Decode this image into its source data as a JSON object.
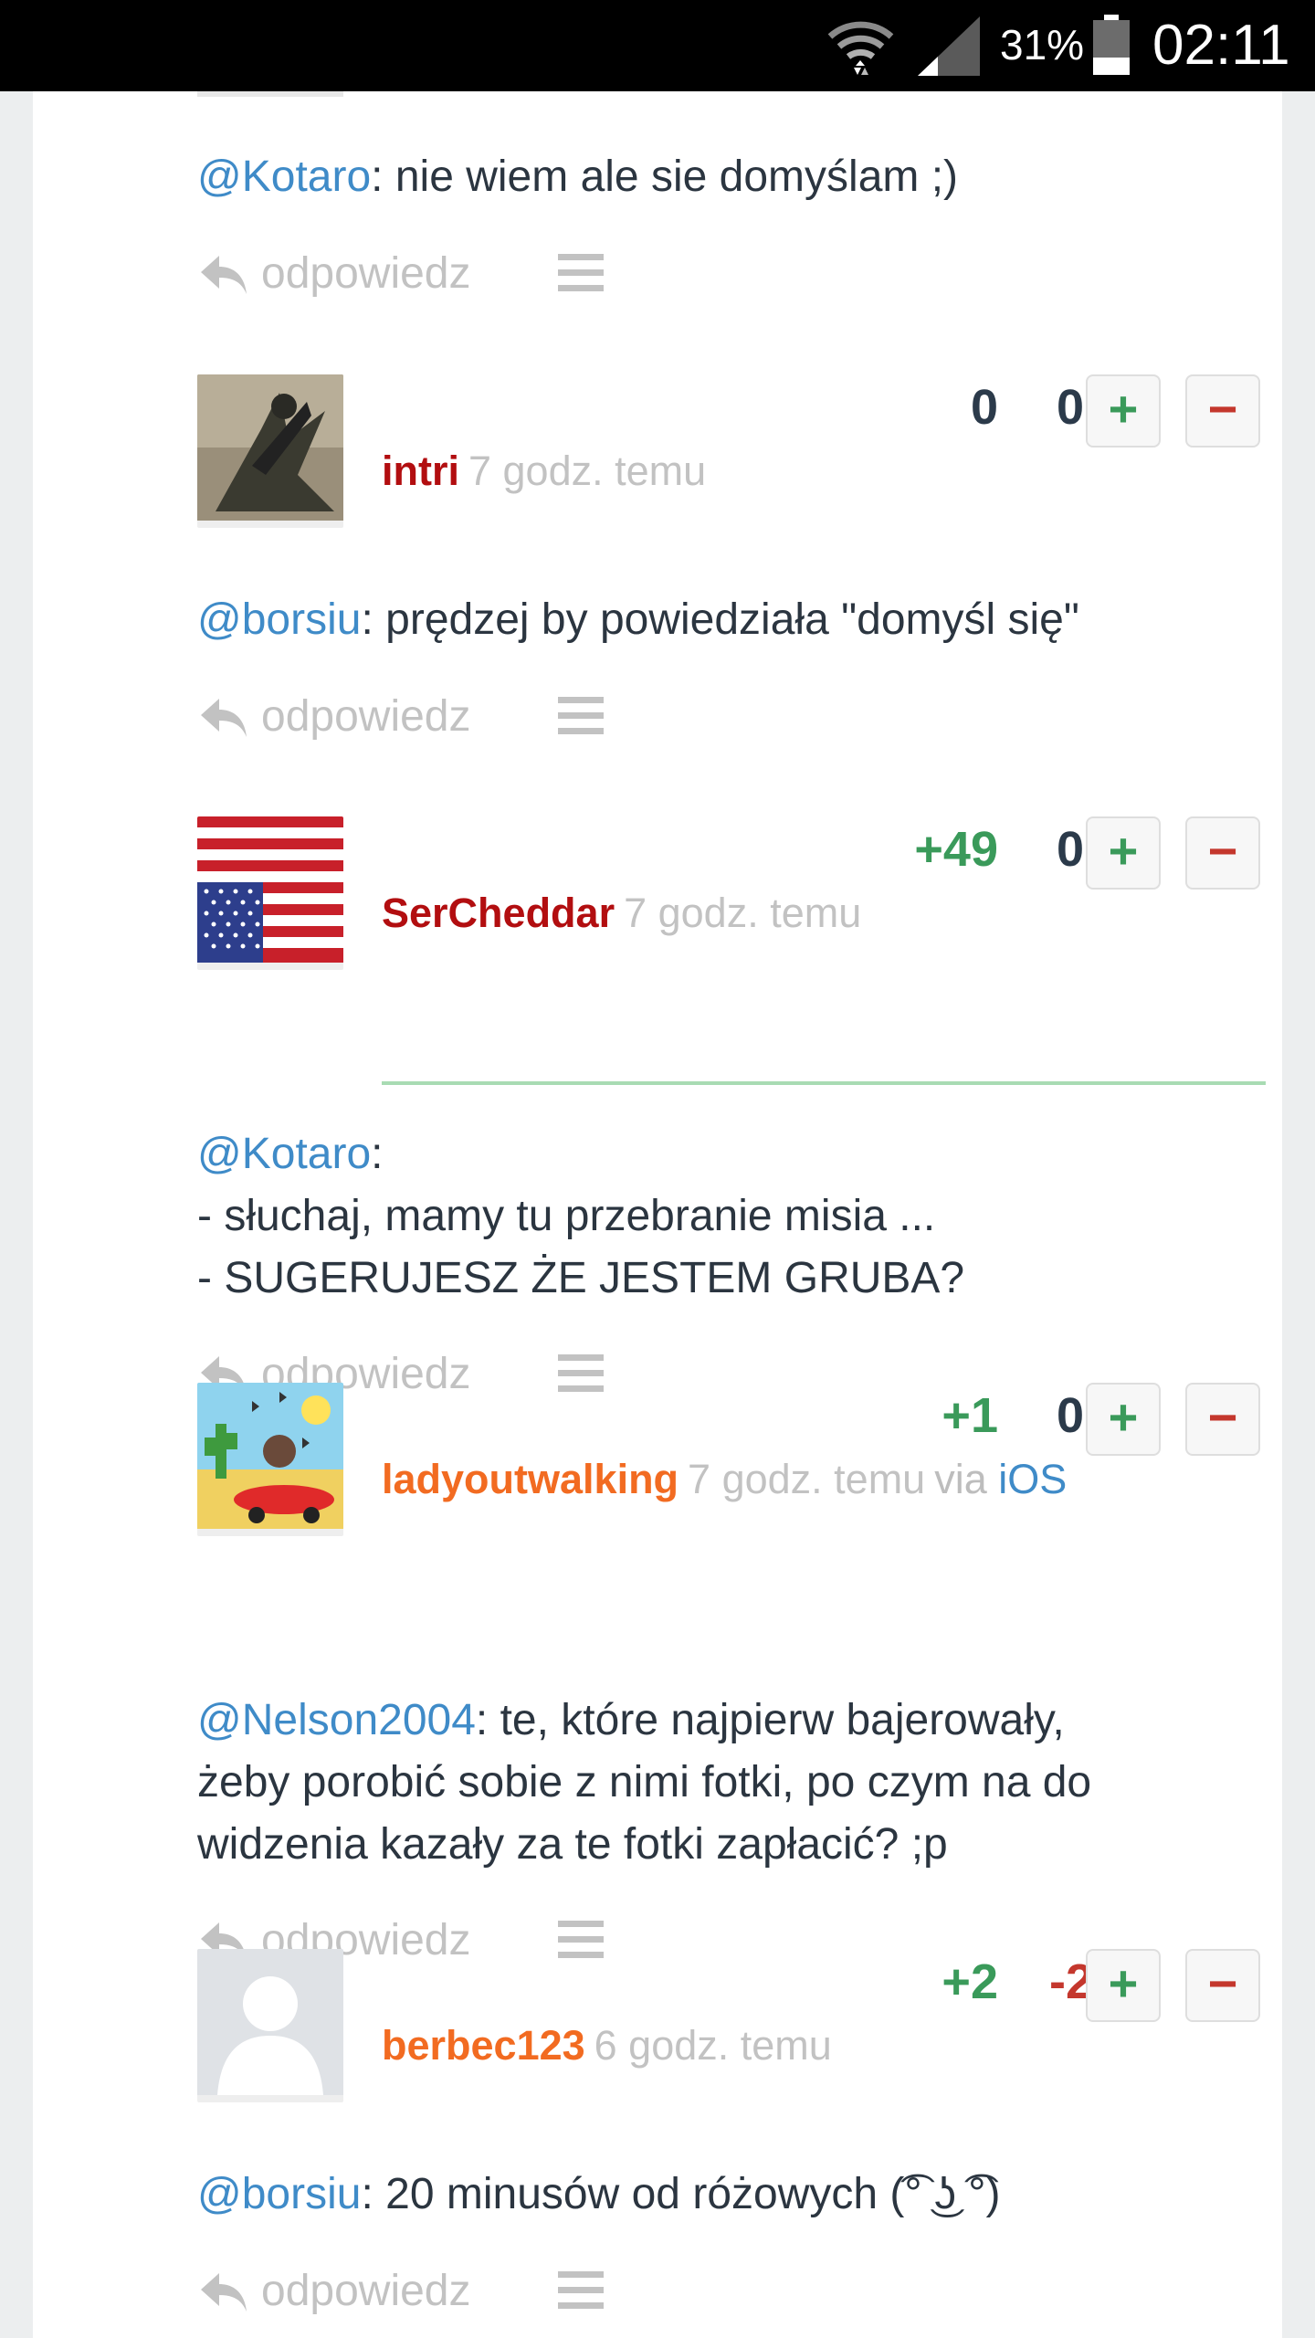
{
  "status_bar": {
    "battery": "31%",
    "time": "02:11"
  },
  "comments": [
    {
      "body": {
        "mention": "@Kotaro",
        "text": ": nie wiem ale sie domyślam ;)"
      },
      "reply_label": "odpowiedz"
    },
    {
      "username": "intri",
      "time": "7 godz. temu",
      "score_plus": "0",
      "score_minus": "0",
      "body": {
        "mention": "@borsiu",
        "text": ": prędzej by powiedziała \"domyśl się\""
      },
      "reply_label": "odpowiedz"
    },
    {
      "username": "SerCheddar",
      "time": "7 godz. temu",
      "score_plus": "+49",
      "score_minus": "0",
      "body": {
        "mention": "@Kotaro",
        "text": ":",
        "line2": "- słuchaj, mamy tu przebranie misia ...",
        "line3": "- SUGERUJESZ ŻE JESTEM GRUBA?"
      },
      "reply_label": "odpowiedz"
    },
    {
      "username": "ladyoutwalking",
      "time": "7 godz. temu",
      "via": "via",
      "via_link": "iOS",
      "score_plus": "+1",
      "score_minus": "0",
      "body": {
        "mention": "@Nelson2004",
        "text": ": te, które najpierw bajerowały,",
        "line2": "żeby porobić sobie z nimi fotki, po czym na do",
        "line3": "widzenia kazały za te fotki zapłacić? ;p"
      },
      "reply_label": "odpowiedz"
    },
    {
      "username": "berbec123",
      "time": "6 godz. temu",
      "score_plus": "+2",
      "score_minus": "-2",
      "body": {
        "mention": "@borsiu",
        "text": ": 20 minusów od różowych (͡° ͜ʖ ͡°)"
      },
      "reply_label": "odpowiedz"
    }
  ],
  "vote_buttons": {
    "plus": "+",
    "minus": "−"
  },
  "colors": {
    "username_red": "#b20e10",
    "username_orange": "#f26b21",
    "mention_blue": "#3f8bc8",
    "score_green": "#3a9a5a",
    "score_red": "#c4372d",
    "score_dark": "#2b3a4a"
  },
  "icons": [
    "wifi-icon",
    "signal-icon",
    "battery-icon",
    "reply-icon",
    "menu-icon"
  ]
}
